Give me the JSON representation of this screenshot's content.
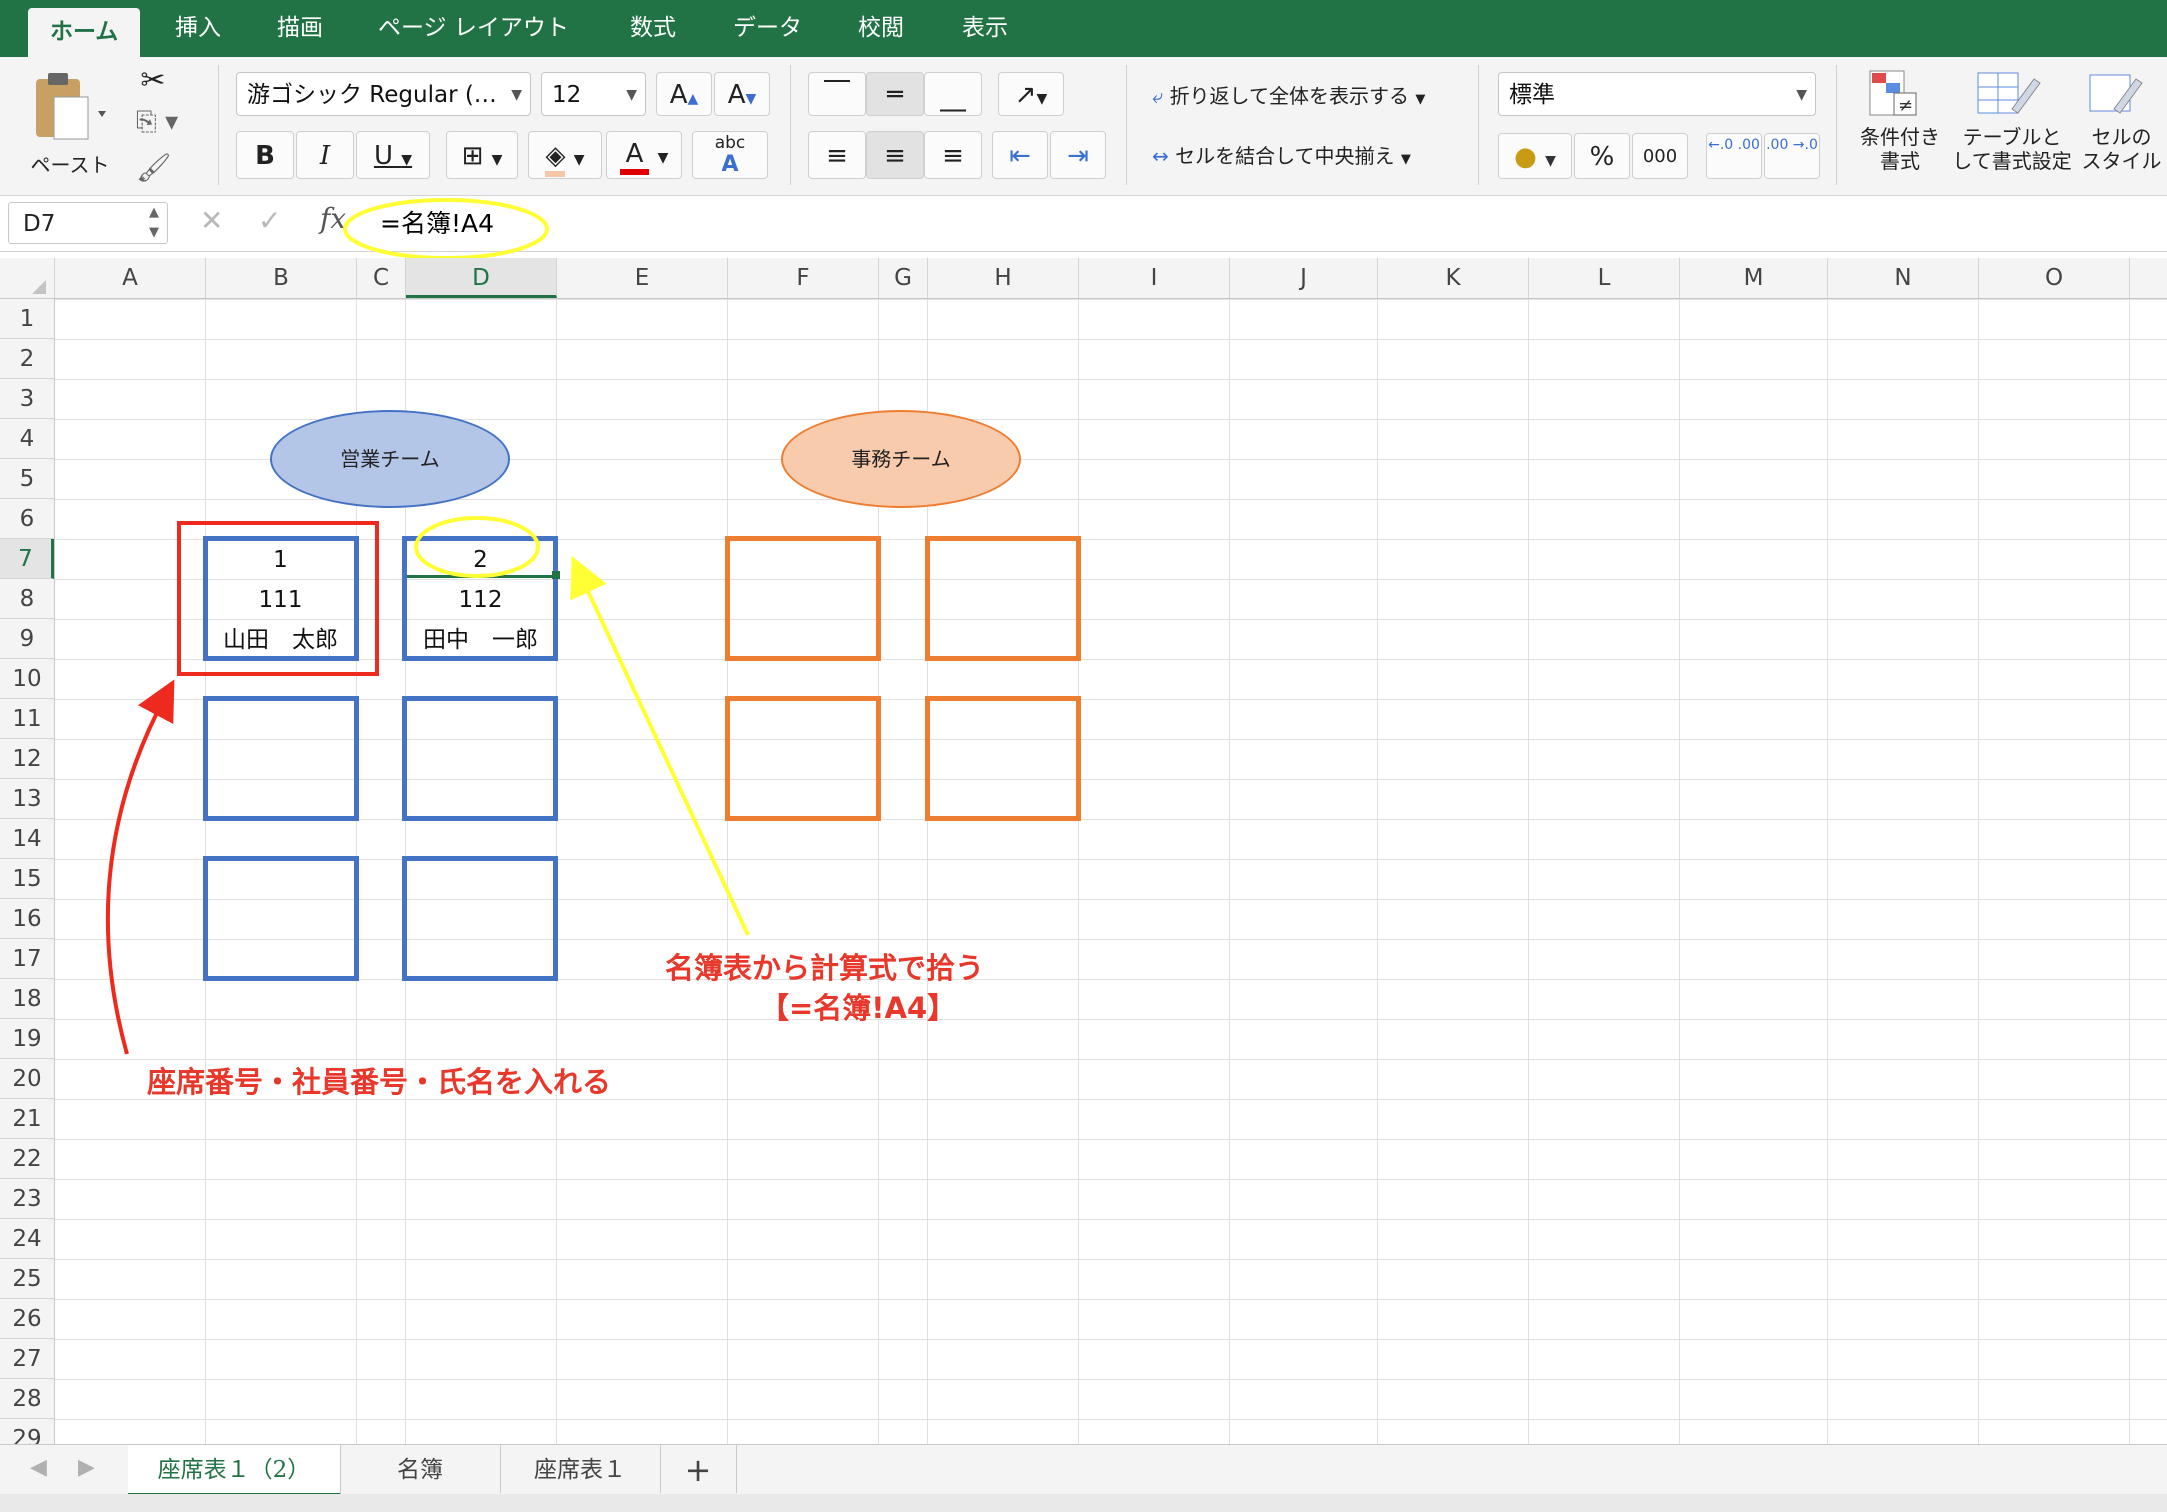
{
  "ribbon_tabs": [
    "ホーム",
    "挿入",
    "描画",
    "ページ レイアウト",
    "数式",
    "データ",
    "校閲",
    "表示"
  ],
  "clipboard": {
    "paste_label": "ペースト"
  },
  "font": {
    "name": "游ゴシック Regular (…",
    "size": "12",
    "bold": "B",
    "italic": "I",
    "underline": "U",
    "grow": "A",
    "shrink": "A",
    "color_letter": "A",
    "phonetic": "abc"
  },
  "alignment": {
    "wrap_label": "折り返して全体を表示する",
    "merge_label": "セルを結合して中央揃え"
  },
  "number": {
    "format": "標準",
    "percent": "%",
    "comma": "000",
    "inc_dec": "←.0 .00",
    "dec_dec": ".00 →.0"
  },
  "styles": {
    "conditional_l1": "条件付き",
    "conditional_l2": "書式",
    "table_l1": "テーブルと",
    "table_l2": "して書式設定",
    "cell_l1": "セルの",
    "cell_l2": "スタイル"
  },
  "formula_bar": {
    "cell_ref": "D7",
    "fx": "fx",
    "formula": "=名簿!A4"
  },
  "columns": [
    "A",
    "B",
    "C",
    "D",
    "E",
    "F",
    "G",
    "H",
    "I",
    "J",
    "K",
    "L",
    "M",
    "N",
    "O"
  ],
  "rows": [
    "1",
    "2",
    "3",
    "4",
    "5",
    "6",
    "7",
    "8",
    "9",
    "10",
    "11",
    "12",
    "13",
    "14",
    "15",
    "16",
    "17",
    "18",
    "19",
    "20",
    "21",
    "22",
    "23",
    "24",
    "25",
    "26",
    "27",
    "28",
    "29"
  ],
  "selected": {
    "column": "D",
    "row": "7"
  },
  "cells": {
    "B7": "1",
    "B8": "111",
    "B9": "山田　太郎",
    "D7": "2",
    "D8": "112",
    "D9": "田中　一郎"
  },
  "shapes": {
    "sales_team": "営業チーム",
    "office_team": "事務チーム"
  },
  "annotations": {
    "formula_note_l1": "名簿表から計算式で拾う",
    "formula_note_l2": "【=名簿!A4】",
    "input_note": "座席番号・社員番号・氏名を入れる"
  },
  "sheet_tabs": [
    "座席表１（2）",
    "名簿",
    "座席表１"
  ],
  "add_sheet": "+",
  "colors": {
    "excel_green": "#217346",
    "seat_blue": "#4472c4",
    "seat_orange": "#ed7d31",
    "annot_red": "#e8382b",
    "highlight_yellow": "#ffff33"
  }
}
